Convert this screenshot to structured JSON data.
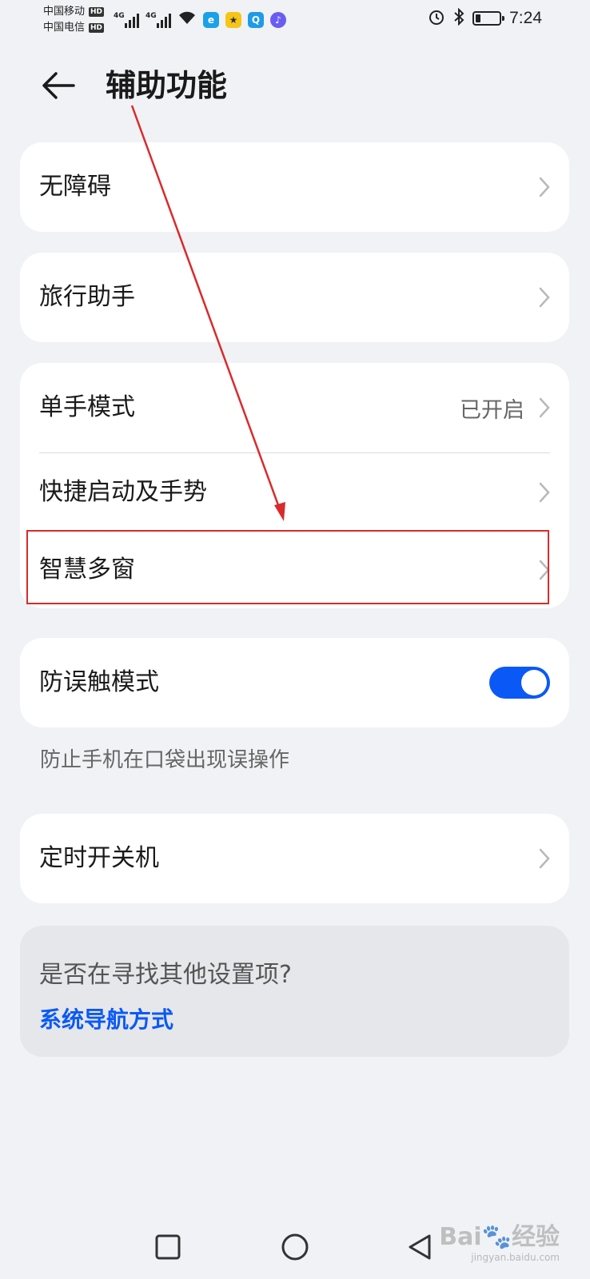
{
  "status_bar": {
    "carrier_1": "中国移动",
    "carrier_2": "中国电信",
    "hd_badge": "HD",
    "network_1": "4G",
    "network_2": "4G",
    "time": "7:24",
    "battery_level": 0.2
  },
  "header": {
    "title": "辅助功能",
    "back_icon": "back-arrow-icon"
  },
  "cards": {
    "accessibility": {
      "label": "无障碍"
    },
    "travel_assistant": {
      "label": "旅行助手"
    },
    "one_hand": {
      "label": "单手模式",
      "value": "已开启"
    },
    "shortcuts": {
      "label": "快捷启动及手势"
    },
    "multi_window": {
      "label": "智慧多窗"
    },
    "anti_touch": {
      "label": "防误触模式",
      "enabled": true,
      "hint": "防止手机在口袋出现误操作"
    },
    "schedule_power": {
      "label": "定时开关机"
    }
  },
  "suggestion": {
    "question": "是否在寻找其他设置项?",
    "link": "系统导航方式"
  },
  "navbar": {
    "recent_icon": "square-icon",
    "home_icon": "circle-icon",
    "back_icon": "triangle-back-icon"
  },
  "watermark": {
    "brand": "Bai",
    "brand_2": "经验",
    "url": "jingyan.baidu.com"
  },
  "colors": {
    "accent": "#0a59f7",
    "background": "#f1f2f6",
    "annotation_red": "#d92b2b"
  }
}
